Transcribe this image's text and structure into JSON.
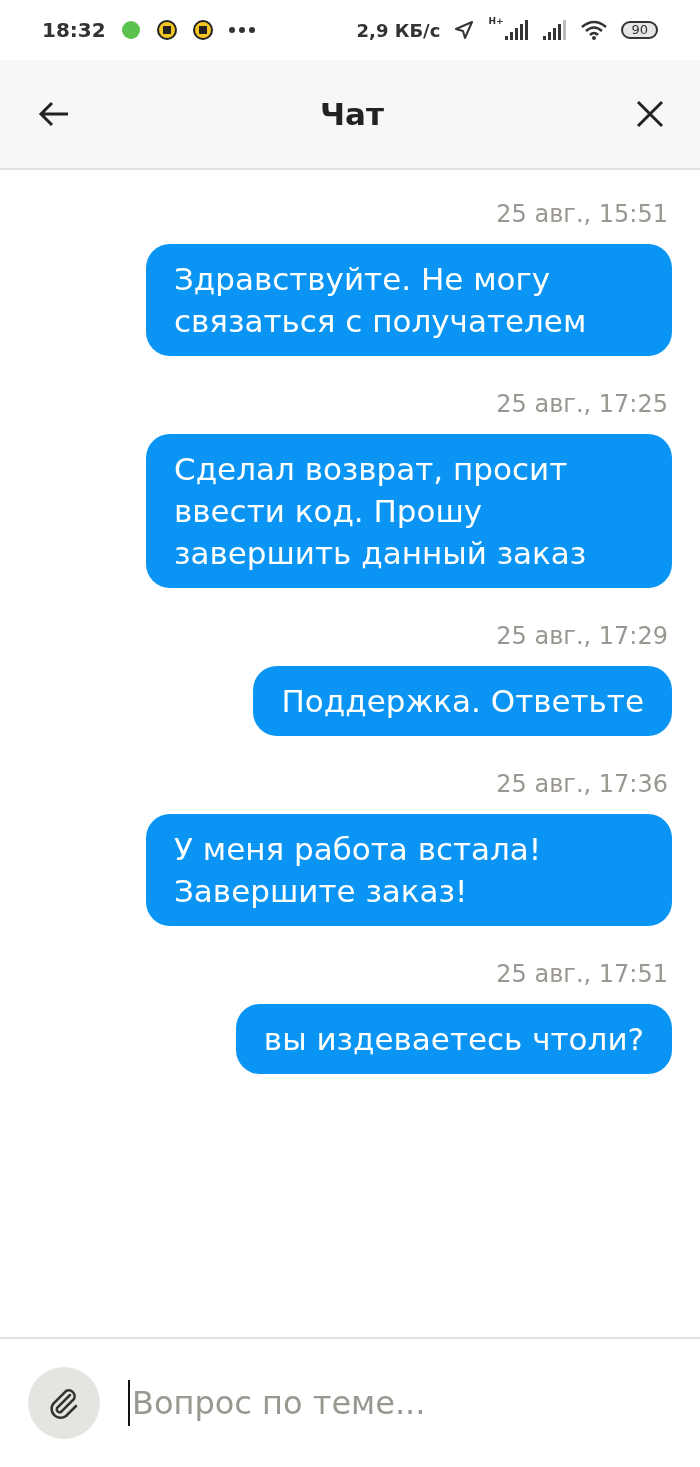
{
  "status_bar": {
    "time": "18:32",
    "speed": "2,9 КБ/с",
    "network": "H+",
    "battery": "90"
  },
  "header": {
    "title": "Чат"
  },
  "messages": [
    {
      "time": "25 авг., 15:51",
      "text": "Здравствуйте. Не могу связаться с получателем"
    },
    {
      "time": "25 авг., 17:25",
      "text": "Сделал возврат, просит ввести код. Прошу завершить данный заказ"
    },
    {
      "time": "25 авг., 17:29",
      "text": "Поддержка. Ответьте"
    },
    {
      "time": "25 авг., 17:36",
      "text": "У меня работа встала! Завершите заказ!"
    },
    {
      "time": "25 авг., 17:51",
      "text": "вы издеваетесь чтоли?"
    }
  ],
  "composer": {
    "placeholder": "Вопрос по теме..."
  }
}
